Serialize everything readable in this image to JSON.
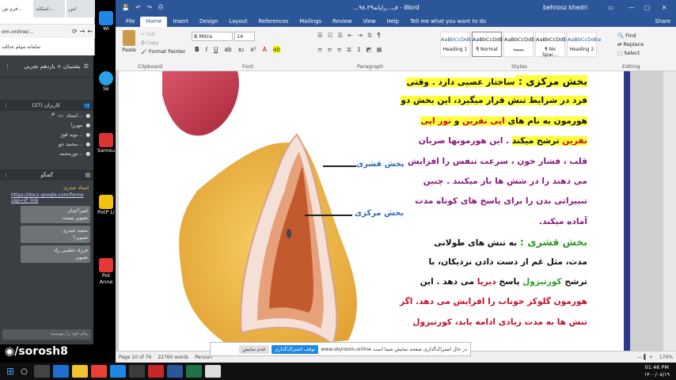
{
  "browser": {
    "tabs": [
      "فرم ش...",
      "اسکاید...",
      "اس"
    ],
    "url": "om.online/...",
    "bookmark": "سامانه سپام عدالت"
  },
  "skyroom": {
    "title": "پشتیبان + یازدهم تجربی",
    "users_header": "کاربران (27)",
    "users": [
      "استاد...",
      "مهرزا",
      "نوید فوژ...",
      "محمد جو...",
      "نورمحمد..."
    ],
    "chat_header": "گفتگو",
    "chat_sender": "استاد حیدری",
    "chat_link": "https://docs.google.com/forms",
    "chat_link2": "usp=sf_link",
    "messages": [
      {
        "name": "امیر؟چیان",
        "text": "تصویر نیست"
      },
      {
        "name": "سعید حیدری",
        "text": "تصویر؟"
      },
      {
        "name": "فرزاد خطیبی راد",
        "text": "تصویر"
      }
    ],
    "input_placeholder": "پیام خود را بنویسید"
  },
  "watermark": "/sorosh8",
  "desktop_icons": [
    "Wi",
    "Sk",
    "Samsu",
    "PotP Li",
    "Pot Anne"
  ],
  "word": {
    "quick_icons": [
      "save-icon",
      "undo-icon",
      "redo-icon",
      "print-icon"
    ],
    "doc_title": "...ف...رایانه۹۸.۲۹ - Word",
    "user": "behrooz khedri",
    "tabs": [
      "File",
      "Home",
      "Insert",
      "Design",
      "Layout",
      "References",
      "Mailings",
      "Review",
      "View",
      "Help",
      "Tell me what you want to do"
    ],
    "active_tab": "Home",
    "share_label": "Share",
    "clipboard": {
      "paste": "Paste",
      "cut": "Cut",
      "copy": "Copy",
      "painter": "Format Painter",
      "label": "Clipboard"
    },
    "font": {
      "name": "B Mitra",
      "size": "14",
      "label": "Font"
    },
    "paragraph_label": "Paragraph",
    "styles": [
      {
        "preview": "AaBbCcDdEe",
        "name": "Heading 1"
      },
      {
        "preview": "AaBbCcDdEe",
        "name": "¶ Normal"
      },
      {
        "preview": "AaBbCcDdEe",
        "name": "بسمه"
      },
      {
        "preview": "AaBbCcDdEe",
        "name": "¶ No Spac..."
      },
      {
        "preview": "AaBbCcDdEe",
        "name": "Heading 2"
      }
    ],
    "styles_label": "Styles",
    "editing": {
      "find": "Find",
      "replace": "Replace",
      "select": "Select",
      "label": "Editing"
    },
    "status": {
      "page": "Page 10 of 76",
      "words": "22760 words",
      "lang": "Persian",
      "zoom": "170%"
    }
  },
  "document": {
    "lines": [
      [
        {
          "t": "بخش مرکزی : ",
          "c": "heading hl"
        },
        {
          "t": "ساختار عصبی دارد . وقتی",
          "c": "hl"
        }
      ],
      [
        {
          "t": "فرد در شرایط تنش قرار میگیرد، این بخش دو",
          "c": "hl"
        }
      ],
      [
        {
          "t": "هورمون به نام های ",
          "c": "hl"
        },
        {
          "t": "اپی نفرین",
          "c": "hl red"
        },
        {
          "t": " و ",
          "c": "hl"
        },
        {
          "t": "نور اپی",
          "c": "hl red"
        }
      ],
      [
        {
          "t": "نفرین",
          "c": "hl red"
        },
        {
          "t": " ترشح  میکند",
          "c": "hl"
        },
        {
          "t": " . این هورمونها ضربان",
          "c": "purple"
        }
      ],
      [
        {
          "t": "قلب ، فشار خون ، سرعت تنفس را افزایش",
          "c": "purple"
        }
      ],
      [
        {
          "t": "می دهند را در شش ها باز  میکنند . چنین",
          "c": "purple"
        }
      ],
      [
        {
          "t": "تنییراتی بدن را برای پاسخ های کوتاه مدت",
          "c": "purple"
        }
      ],
      [
        {
          "t": "آماده میکند.",
          "c": "purple"
        }
      ],
      [
        {
          "t": "بخش قشری :",
          "c": "heading green"
        },
        {
          "t": "  به تنش های طولانی",
          "c": ""
        }
      ],
      [
        {
          "t": "مدت، مثل غم از دست دادن نزدیکان، با",
          "c": ""
        }
      ],
      [
        {
          "t": "ترشح ",
          "c": ""
        },
        {
          "t": "کورتیزول",
          "c": "green"
        },
        {
          "t": " پاسخ ",
          "c": ""
        },
        {
          "t": "دیرپا",
          "c": "red"
        },
        {
          "t": " می دهد . این",
          "c": ""
        }
      ],
      [
        {
          "t": "هورمون گلوکز خوناب را افزایش می دهد. اگر",
          "c": "red"
        }
      ],
      [
        {
          "t": "تنش ها به مدت زیادی ادامه یابد، کورتیزول",
          "c": "red"
        }
      ]
    ]
  },
  "diagram": {
    "label_cortex": "بخش قشری",
    "label_medulla": "بخش مرکزی"
  },
  "notice": {
    "text": "در حال اشتراک‌گذاری صفحه نمایش شما است www.skyroom.online",
    "stop": "توقف اشتراک‌گذاری",
    "hide": "عدم نمایش"
  },
  "taskbar": {
    "time": "01:46 PM",
    "date": "۱۴۰۰/۰۸/۱۹"
  },
  "colors": {
    "word_blue": "#2b579a",
    "highlight": "#ffff3a",
    "sky_bg": "#3b3f44"
  }
}
